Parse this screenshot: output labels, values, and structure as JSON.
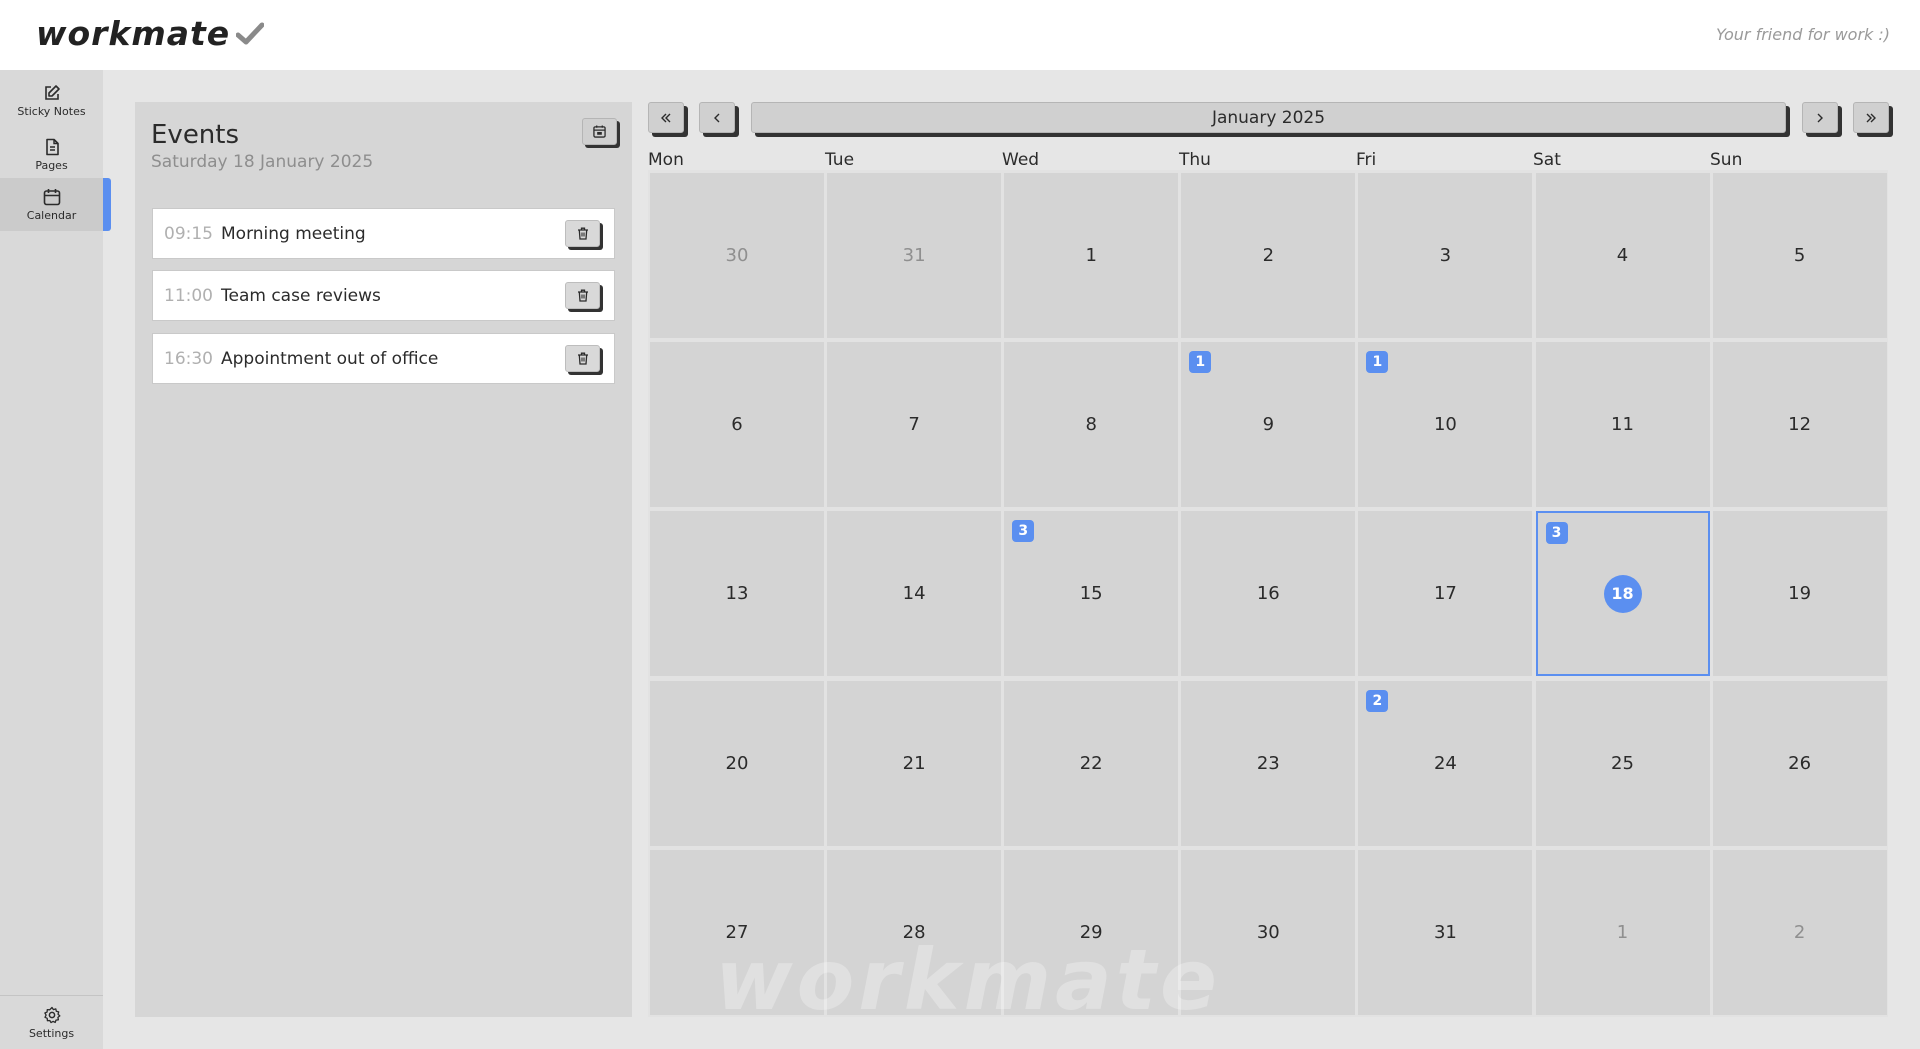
{
  "header": {
    "logo_text": "workmate",
    "tagline": "Your friend for work :)"
  },
  "sidebar": {
    "items": [
      {
        "label": "Sticky Notes",
        "icon": "edit-icon"
      },
      {
        "label": "Pages",
        "icon": "document-icon"
      },
      {
        "label": "Calendar",
        "icon": "calendar-icon",
        "active": true
      }
    ],
    "settings": {
      "label": "Settings",
      "icon": "gear-icon"
    }
  },
  "events_panel": {
    "title": "Events",
    "date": "Saturday 18 January 2025",
    "events": [
      {
        "time": "09:15",
        "title": "Morning meeting"
      },
      {
        "time": "11:00",
        "title": "Team case reviews"
      },
      {
        "time": "16:30",
        "title": "Appointment out of office"
      }
    ]
  },
  "calendar": {
    "month_label": "January 2025",
    "weekdays": [
      "Mon",
      "Tue",
      "Wed",
      "Thu",
      "Fri",
      "Sat",
      "Sun"
    ],
    "weeks": [
      [
        {
          "day": "30",
          "muted": true
        },
        {
          "day": "31",
          "muted": true
        },
        {
          "day": "1"
        },
        {
          "day": "2"
        },
        {
          "day": "3"
        },
        {
          "day": "4"
        },
        {
          "day": "5"
        }
      ],
      [
        {
          "day": "6"
        },
        {
          "day": "7"
        },
        {
          "day": "8"
        },
        {
          "day": "9",
          "badge": "1"
        },
        {
          "day": "10",
          "badge": "1"
        },
        {
          "day": "11"
        },
        {
          "day": "12"
        }
      ],
      [
        {
          "day": "13"
        },
        {
          "day": "14"
        },
        {
          "day": "15",
          "badge": "3"
        },
        {
          "day": "16"
        },
        {
          "day": "17"
        },
        {
          "day": "18",
          "badge": "3",
          "selected": true
        },
        {
          "day": "19"
        }
      ],
      [
        {
          "day": "20"
        },
        {
          "day": "21"
        },
        {
          "day": "22"
        },
        {
          "day": "23"
        },
        {
          "day": "24",
          "badge": "2"
        },
        {
          "day": "25"
        },
        {
          "day": "26"
        }
      ],
      [
        {
          "day": "27"
        },
        {
          "day": "28"
        },
        {
          "day": "29"
        },
        {
          "day": "30"
        },
        {
          "day": "31"
        },
        {
          "day": "1",
          "muted": true
        },
        {
          "day": "2",
          "muted": true
        }
      ]
    ],
    "watermark": "workmate"
  },
  "colors": {
    "accent": "#5b8ff0"
  }
}
